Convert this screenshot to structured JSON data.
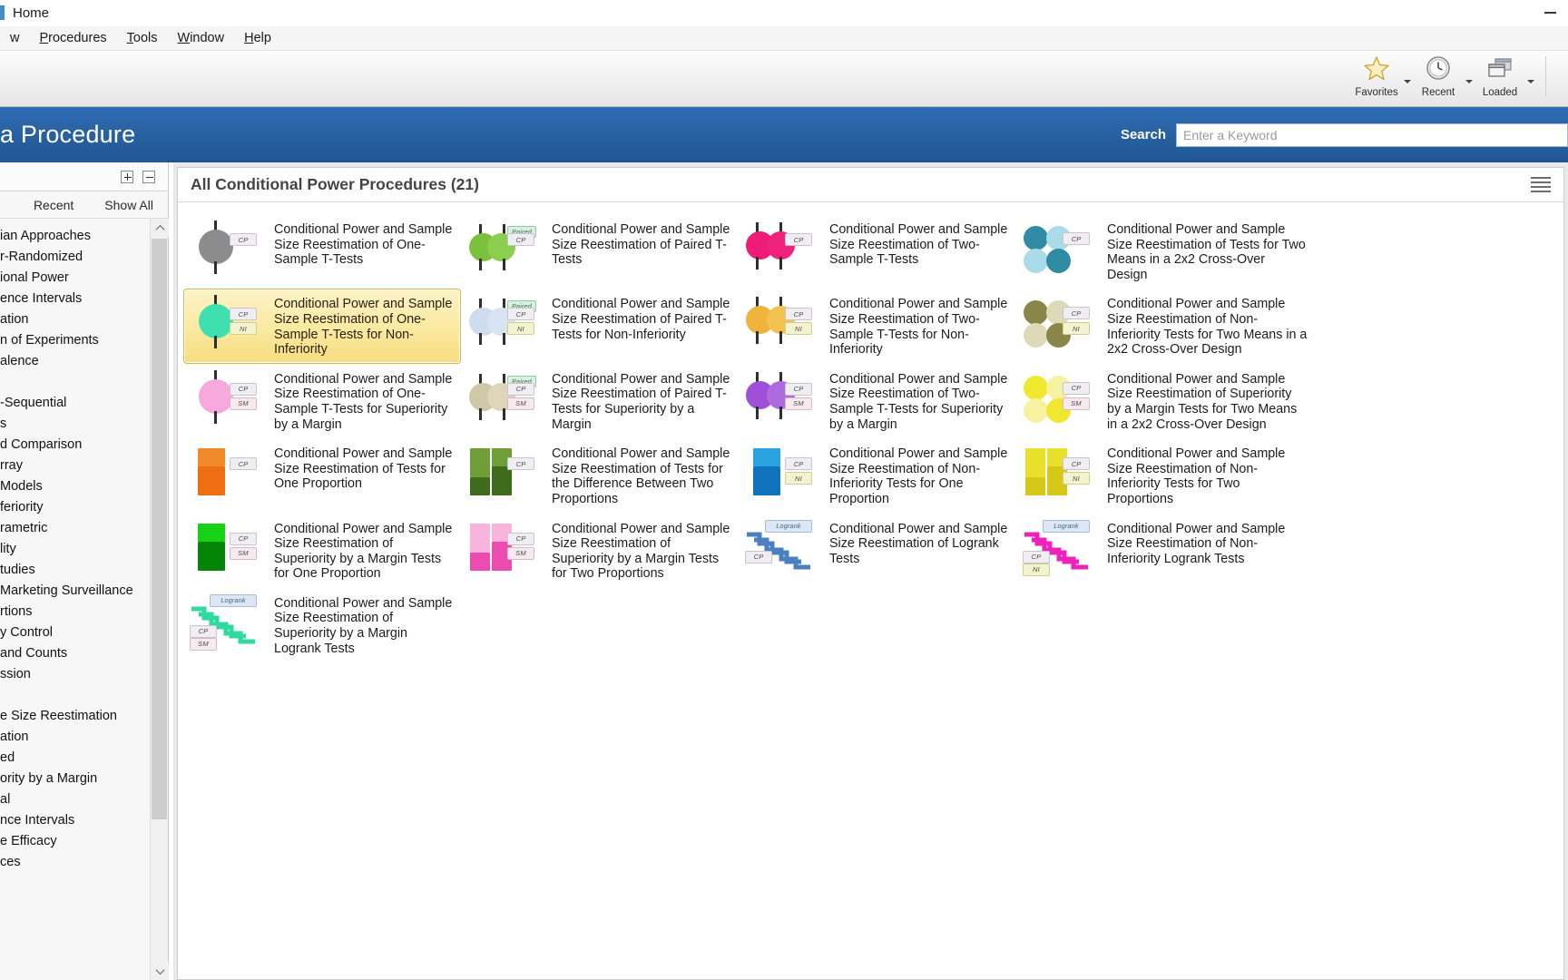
{
  "window": {
    "title": "Home",
    "minimize_label": "minimize"
  },
  "menubar": {
    "items": [
      {
        "label": "w",
        "name": "menu-window-clipped"
      },
      {
        "label": "Procedures",
        "name": "menu-procedures"
      },
      {
        "label": "Tools",
        "name": "menu-tools"
      },
      {
        "label": "Window",
        "name": "menu-window"
      },
      {
        "label": "Help",
        "name": "menu-help"
      }
    ]
  },
  "ribbon": {
    "buttons": [
      {
        "label": "Favorites",
        "icon": "star-icon"
      },
      {
        "label": "Recent",
        "icon": "clock-icon"
      },
      {
        "label": "Loaded",
        "icon": "windows-icon"
      }
    ]
  },
  "header": {
    "title": "a Procedure",
    "search_label": "Search",
    "search_placeholder": "Enter a Keyword",
    "search_value": ""
  },
  "sidebar": {
    "expand_label": "expand-all",
    "collapse_label": "collapse-all",
    "tabs": [
      {
        "label": "Recent"
      },
      {
        "label": "Show All"
      }
    ],
    "items": [
      {
        "label": "ian Approaches",
        "selected": false
      },
      {
        "label": "r-Randomized",
        "selected": false
      },
      {
        "label": "ional Power",
        "selected": true
      },
      {
        "label": "ence Intervals",
        "selected": false
      },
      {
        "label": "ation",
        "selected": false
      },
      {
        "label": "n of Experiments",
        "selected": false
      },
      {
        "label": "alence",
        "selected": false
      },
      {
        "label": "",
        "selected": false
      },
      {
        "label": "-Sequential",
        "selected": false
      },
      {
        "label": "s",
        "selected": false
      },
      {
        "label": "d Comparison",
        "selected": false
      },
      {
        "label": "rray",
        "selected": false
      },
      {
        "label": " Models",
        "selected": false
      },
      {
        "label": "feriority",
        "selected": false
      },
      {
        "label": "rametric",
        "selected": false
      },
      {
        "label": "lity",
        "selected": false
      },
      {
        "label": "tudies",
        "selected": false
      },
      {
        "label": "Marketing Surveillance",
        "selected": false
      },
      {
        "label": "rtions",
        "selected": false
      },
      {
        "label": "y Control",
        "selected": false
      },
      {
        "label": " and Counts",
        "selected": false
      },
      {
        "label": "ssion",
        "selected": false
      },
      {
        "label": "",
        "selected": false
      },
      {
        "label": "e Size Reestimation",
        "selected": false
      },
      {
        "label": "ation",
        "selected": false
      },
      {
        "label": "ed",
        "selected": false
      },
      {
        "label": "ority by a Margin",
        "selected": false
      },
      {
        "label": "al",
        "selected": false
      },
      {
        "label": "nce Intervals",
        "selected": false
      },
      {
        "label": "e Efficacy",
        "selected": false
      },
      {
        "label": "ces",
        "selected": false
      }
    ]
  },
  "main": {
    "title": "All Conditional Power Procedures (21)",
    "view_toggle": "list-view-icon",
    "procedures": [
      {
        "label": "Conditional Power and Sample Size Reestimation of One-Sample T-Tests",
        "icon": "one-sample-circle",
        "colors": [
          "#8c8c8c"
        ],
        "badges": [
          "CP"
        ],
        "selected": false
      },
      {
        "label": "Conditional Power and Sample Size Reestimation of Paired T-Tests",
        "icon": "paired-circles",
        "colors": [
          "#7cc13e",
          "#8ccf4f"
        ],
        "badges": [
          "Paired",
          "CP"
        ],
        "selected": false
      },
      {
        "label": "Conditional Power and Sample Size Reestimation of Two-Sample T-Tests",
        "icon": "two-sample-circles",
        "colors": [
          "#ef1b78",
          "#f0217d"
        ],
        "badges": [
          "CP"
        ],
        "selected": false
      },
      {
        "label": "Conditional Power and Sample Size Reestimation of Tests for Two Means in a 2x2 Cross-Over Design",
        "icon": "crossover-2x2-circles",
        "colors": [
          "#2f8ca3",
          "#a9dce8"
        ],
        "badges": [
          "CP"
        ],
        "selected": false
      },
      {
        "label": "Conditional Power and Sample Size Reestimation of One-Sample T-Tests for Non-Inferiority",
        "icon": "one-sample-circle",
        "colors": [
          "#3fe0b0"
        ],
        "badges": [
          "CP",
          "NI"
        ],
        "selected": true
      },
      {
        "label": "Conditional Power and Sample Size Reestimation of Paired T-Tests for Non-Inferiority",
        "icon": "paired-circles",
        "colors": [
          "#cfdcee",
          "#d9e4f2"
        ],
        "badges": [
          "Paired",
          "CP",
          "NI"
        ],
        "selected": false
      },
      {
        "label": "Conditional Power and Sample Size Reestimation of Two-Sample T-Tests for Non-Inferiority",
        "icon": "two-sample-circles",
        "colors": [
          "#f0b33c",
          "#f3c251"
        ],
        "badges": [
          "CP",
          "NI"
        ],
        "selected": false
      },
      {
        "label": "Conditional Power and Sample Size Reestimation of Non-Inferiority Tests for Two Means in a 2x2 Cross-Over Design",
        "icon": "crossover-2x2-circles",
        "colors": [
          "#8a8548",
          "#ddd9b9"
        ],
        "badges": [
          "CP",
          "NI"
        ],
        "selected": false
      },
      {
        "label": "Conditional Power and Sample Size Reestimation of One-Sample T-Tests for Superiority by a Margin",
        "icon": "one-sample-circle",
        "colors": [
          "#f7a8dc"
        ],
        "badges": [
          "CP",
          "SM"
        ],
        "selected": false
      },
      {
        "label": "Conditional Power and Sample Size Reestimation of Paired T-Tests for Superiority by a Margin",
        "icon": "paired-circles",
        "colors": [
          "#cfc8a8",
          "#ddd6bb"
        ],
        "badges": [
          "Paired",
          "CP",
          "SM"
        ],
        "selected": false
      },
      {
        "label": "Conditional Power and Sample Size Reestimation of Two-Sample T-Tests for Superiority by a Margin",
        "icon": "two-sample-circles",
        "colors": [
          "#9f4fd8",
          "#b06ae0"
        ],
        "badges": [
          "CP",
          "SM"
        ],
        "selected": false
      },
      {
        "label": "Conditional Power and Sample Size Reestimation of Superiority by a Margin Tests for Two Means in a 2x2 Cross-Over Design",
        "icon": "crossover-2x2-circles",
        "colors": [
          "#efe82e",
          "#f7f2a0"
        ],
        "badges": [
          "CP",
          "SM"
        ],
        "selected": false
      },
      {
        "label": "Conditional Power and Sample Size Reestimation of Tests for One Proportion",
        "icon": "one-proportion-bar",
        "colors": [
          "#f08a2a",
          "#ee6e11"
        ],
        "badges": [
          "CP"
        ],
        "selected": false
      },
      {
        "label": "Conditional Power and Sample Size Reestimation of Tests for the Difference Between Two Proportions",
        "icon": "two-proportion-bars",
        "colors": [
          "#6f9e39",
          "#3f6b1d"
        ],
        "badges": [
          "CP"
        ],
        "selected": false
      },
      {
        "label": "Conditional Power and Sample Size Reestimation of Non-Inferiority Tests for One Proportion",
        "icon": "one-proportion-bar",
        "colors": [
          "#2aa3e0",
          "#0f74bd"
        ],
        "badges": [
          "CP",
          "NI"
        ],
        "selected": false
      },
      {
        "label": "Conditional Power and Sample Size Reestimation of Non-Inferiority Tests for Two Proportions",
        "icon": "two-proportion-bars",
        "colors": [
          "#e8e02a",
          "#d6c81a"
        ],
        "badges": [
          "CP",
          "NI"
        ],
        "selected": false
      },
      {
        "label": "Conditional Power and Sample Size Reestimation of Superiority by a Margin Tests for One Proportion",
        "icon": "one-proportion-bar",
        "colors": [
          "#17d117",
          "#068406"
        ],
        "badges": [
          "CP",
          "SM"
        ],
        "selected": false
      },
      {
        "label": "Conditional Power and Sample Size Reestimation of Superiority by a Margin Tests for Two Proportions",
        "icon": "two-proportion-bars",
        "colors": [
          "#f9b4de",
          "#ec4bb0"
        ],
        "badges": [
          "CP",
          "SM"
        ],
        "selected": false
      },
      {
        "label": "Conditional Power and Sample Size Reestimation of Logrank Tests",
        "icon": "logrank-steps",
        "colors": [
          "#4a80c0"
        ],
        "badges": [
          "Logrank",
          "CP"
        ],
        "selected": false
      },
      {
        "label": "Conditional Power and Sample Size Reestimation of Non-Inferiority Logrank Tests",
        "icon": "logrank-steps",
        "colors": [
          "#ee22bb"
        ],
        "badges": [
          "Logrank",
          "CP",
          "NI"
        ],
        "selected": false
      },
      {
        "label": "Conditional Power and Sample Size Reestimation of Superiority by a Margin Logrank Tests",
        "icon": "logrank-steps",
        "colors": [
          "#2fd9a0"
        ],
        "badges": [
          "Logrank",
          "CP",
          "SM"
        ],
        "selected": false
      }
    ]
  }
}
